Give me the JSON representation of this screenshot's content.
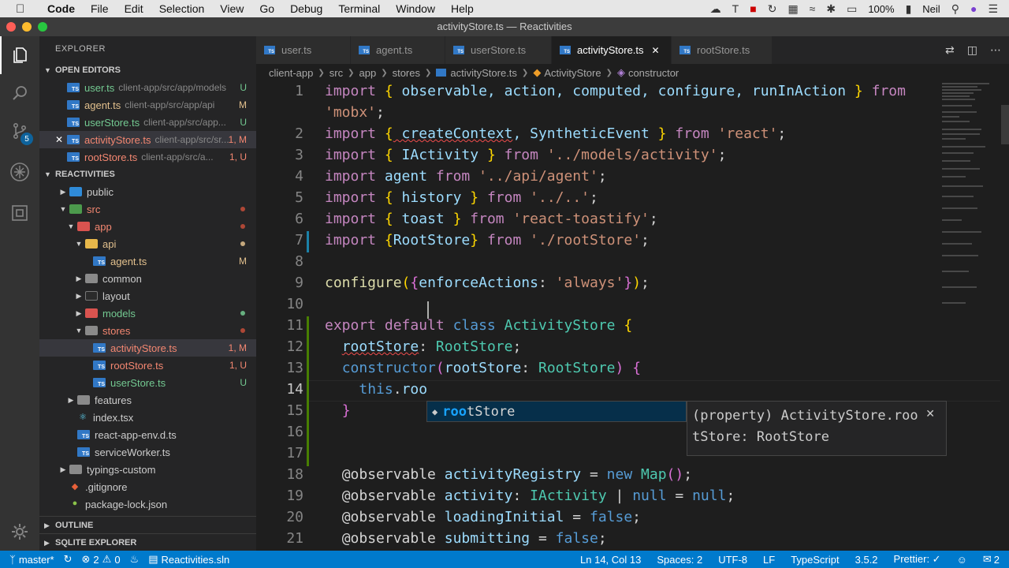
{
  "menubar": {
    "apple_icon": "apple-icon",
    "app_name": "Code",
    "items": [
      "File",
      "Edit",
      "Selection",
      "View",
      "Go",
      "Debug",
      "Terminal",
      "Window",
      "Help"
    ],
    "battery": "100%",
    "user": "Neil"
  },
  "window": {
    "title": "activityStore.ts — Reactivities"
  },
  "sidebar": {
    "title": "EXPLORER",
    "open_editors_label": "OPEN EDITORS",
    "open_editors": [
      {
        "name": "user.ts",
        "path": "client-app/src/app/models",
        "status": "U"
      },
      {
        "name": "agent.ts",
        "path": "client-app/src/app/api",
        "status": "M"
      },
      {
        "name": "userStore.ts",
        "path": "client-app/src/app...",
        "status": "U"
      },
      {
        "name": "activityStore.ts",
        "path": "client-app/src/sr...",
        "status": "1, M"
      },
      {
        "name": "rootStore.ts",
        "path": "client-app/src/a...",
        "status": "1, U"
      }
    ],
    "project_label": "REACTIVITIES",
    "tree": {
      "public": "public",
      "src": "src",
      "app": "app",
      "api": "api",
      "agent": "agent.ts",
      "agent_status": "M",
      "common": "common",
      "layout": "layout",
      "models": "models",
      "stores": "stores",
      "activityStore": "activityStore.ts",
      "activityStore_status": "1, M",
      "rootStore": "rootStore.ts",
      "rootStore_status": "1, U",
      "userStore": "userStore.ts",
      "userStore_status": "U",
      "features": "features",
      "index": "index.tsx",
      "react_app_env": "react-app-env.d.ts",
      "serviceWorker": "serviceWorker.ts",
      "typings": "typings-custom",
      "gitignore": ".gitignore",
      "package_lock": "package-lock.json"
    },
    "outline_label": "OUTLINE",
    "sqlite_label": "SQLITE EXPLORER"
  },
  "activitybar": {
    "scm_badge": "5"
  },
  "tabs": [
    {
      "label": "user.ts"
    },
    {
      "label": "agent.ts"
    },
    {
      "label": "userStore.ts"
    },
    {
      "label": "activityStore.ts"
    },
    {
      "label": "rootStore.ts"
    }
  ],
  "breadcrumb": [
    "client-app",
    "src",
    "app",
    "stores",
    "activityStore.ts",
    "ActivityStore",
    "constructor"
  ],
  "editor": {
    "line_numbers": [
      "1",
      "",
      "2",
      "3",
      "4",
      "5",
      "6",
      "7",
      "8",
      "9",
      "10",
      "11",
      "12",
      "13",
      "14",
      "15",
      "16",
      "17",
      "18",
      "19",
      "20",
      "21"
    ],
    "code": {
      "l1_import": "import",
      "l1_names": " observable, action, computed, configure, runInAction ",
      "l1_from": "from",
      "l1b_str": "'mobx'",
      "l2_import": "import",
      "l2_names_a": " createContext",
      "l2_names_b": ", SyntheticEvent ",
      "l2_from": "from",
      "l2_str": "'react'",
      "l3_import": "import",
      "l3_names": " IActivity ",
      "l3_from": "from",
      "l3_str": "'../models/activity'",
      "l4_import": "import",
      "l4_name": " agent ",
      "l4_from": "from",
      "l4_str": "'../api/agent'",
      "l5_import": "import",
      "l5_names": " history ",
      "l5_from": "from",
      "l5_str": "'../..'",
      "l6_import": "import",
      "l6_names": " toast ",
      "l6_from": "from",
      "l6_str": "'react-toastify'",
      "l7_import": "import",
      "l7_names": "RootStore",
      "l7_from": "from",
      "l7_str": "'./rootStore'",
      "l9_fn": "configure",
      "l9_key": "enforceActions",
      "l9_str": "'always'",
      "l11_export": "export",
      "l11_default": "default",
      "l11_class": "class",
      "l11_name": "ActivityStore",
      "l12_prop": "rootStore",
      "l12_type": "RootStore",
      "l13_ctor": "constructor",
      "l13_param": "rootStore",
      "l13_type": "RootStore",
      "l14_this": "this",
      "l14_partial": "roo",
      "l18_dec": "@observable",
      "l18_name": "activityRegistry",
      "l18_new": "new",
      "l18_type": "Map",
      "l19_dec": "@observable",
      "l19_name": "activity",
      "l19_type": "IActivity",
      "l19_null1": "null",
      "l19_null2": "null",
      "l20_dec": "@observable",
      "l20_name": "loadingInitial",
      "l20_val": "false",
      "l21_dec": "@observable",
      "l21_name": "submitting",
      "l21_val": "false"
    }
  },
  "suggest": {
    "match": "roo",
    "rest": "tStore",
    "details": "(property) ActivityStore.rootStore: RootStore"
  },
  "statusbar": {
    "branch": "master*",
    "errors": "2",
    "warnings": "0",
    "solution": "Reactivities.sln",
    "position": "Ln 14, Col 13",
    "spaces": "Spaces: 2",
    "encoding": "UTF-8",
    "eol": "LF",
    "language": "TypeScript",
    "ts_version": "3.5.2",
    "prettier": "Prettier: ✓",
    "notifications": "2"
  },
  "colors": {
    "accent": "#007acc",
    "untracked": "#73c991",
    "modified": "#e2c08d",
    "error": "#f48771"
  }
}
